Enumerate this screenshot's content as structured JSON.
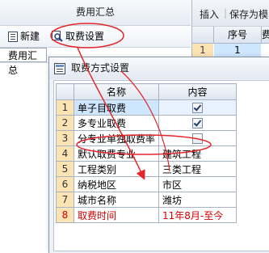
{
  "left_panel": {
    "title": "费用汇总",
    "toolbar": {
      "new_label": "新建",
      "fee_settings_label": "取费设置"
    },
    "tree_label": "费用汇总"
  },
  "right_panel": {
    "tabs": {
      "insert": "插入",
      "separator": "|",
      "save": "保存为模"
    },
    "grid": {
      "seq_header": "序号",
      "fee_header": "费",
      "row_num": "1",
      "row_value": "1"
    }
  },
  "dialog": {
    "title": "取费方式设置",
    "columns": {
      "name": "名称",
      "content": "内容"
    },
    "rows": [
      {
        "num": "1",
        "name": "单子目取费",
        "checked": true
      },
      {
        "num": "2",
        "name": "多专业取费",
        "checked": true
      },
      {
        "num": "3",
        "name": "分专业单独取费率",
        "checked": false
      },
      {
        "num": "4",
        "name": "默认取费专业",
        "value": "建筑工程"
      },
      {
        "num": "5",
        "name": "工程类别",
        "value": "三类工程"
      },
      {
        "num": "6",
        "name": "纳税地区",
        "value": "市区"
      },
      {
        "num": "7",
        "name": "城市名称",
        "value": "潍坊"
      },
      {
        "num": "8",
        "name": "取费时间",
        "value": "11年8月-至今"
      }
    ]
  },
  "annotation_color": "#e3262b",
  "icons": {
    "new": "list-icon",
    "fee_settings": "settings-search-icon",
    "dialog": "settings-window-icon"
  }
}
